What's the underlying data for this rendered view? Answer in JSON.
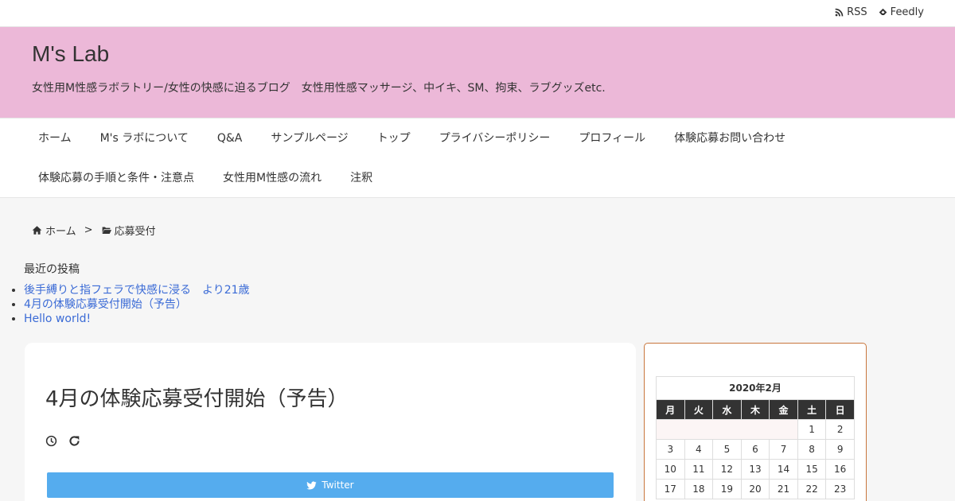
{
  "topbar": {
    "rss_label": "RSS",
    "feedly_label": "Feedly"
  },
  "header": {
    "title": "M's Lab",
    "description": "女性用M性感ラボラトリー/女性の快感に迫るブログ　女性用性感マッサージ、中イキ、SM、拘束、ラブグッズetc."
  },
  "nav": {
    "row1": [
      "ホーム",
      "M's ラボについて",
      "Q&A",
      "サンプルページ",
      "トップ",
      "プライバシーポリシー",
      "プロフィール",
      "体験応募お問い合わせ"
    ],
    "row2": [
      "体験応募の手順と条件・注意点",
      "女性用M性感の流れ",
      "注釈"
    ]
  },
  "breadcrumb": {
    "home": "ホーム",
    "separator": ">",
    "category": "応募受付"
  },
  "recent": {
    "title": "最近の投稿",
    "items": [
      "後手縛りと指フェラで快感に浸る　より21歳",
      "4月の体験応募受付開始（予告）",
      "Hello world!"
    ]
  },
  "post": {
    "title": "4月の体験応募受付開始（予告）",
    "share_twitter": "Twitter"
  },
  "calendar": {
    "caption": "2020年2月",
    "weekdays": [
      "月",
      "火",
      "水",
      "木",
      "金",
      "土",
      "日"
    ],
    "rows": [
      [
        "",
        "",
        "",
        "",
        "",
        "1",
        "2"
      ],
      [
        "3",
        "4",
        "5",
        "6",
        "7",
        "8",
        "9"
      ],
      [
        "10",
        "11",
        "12",
        "13",
        "14",
        "15",
        "16"
      ],
      [
        "17",
        "18",
        "19",
        "20",
        "21",
        "22",
        "23"
      ]
    ]
  },
  "colors": {
    "header_bg": "#ecb8d8",
    "link": "#3b6bd6",
    "twitter": "#55acee",
    "sidebar_border": "#c8763c"
  }
}
